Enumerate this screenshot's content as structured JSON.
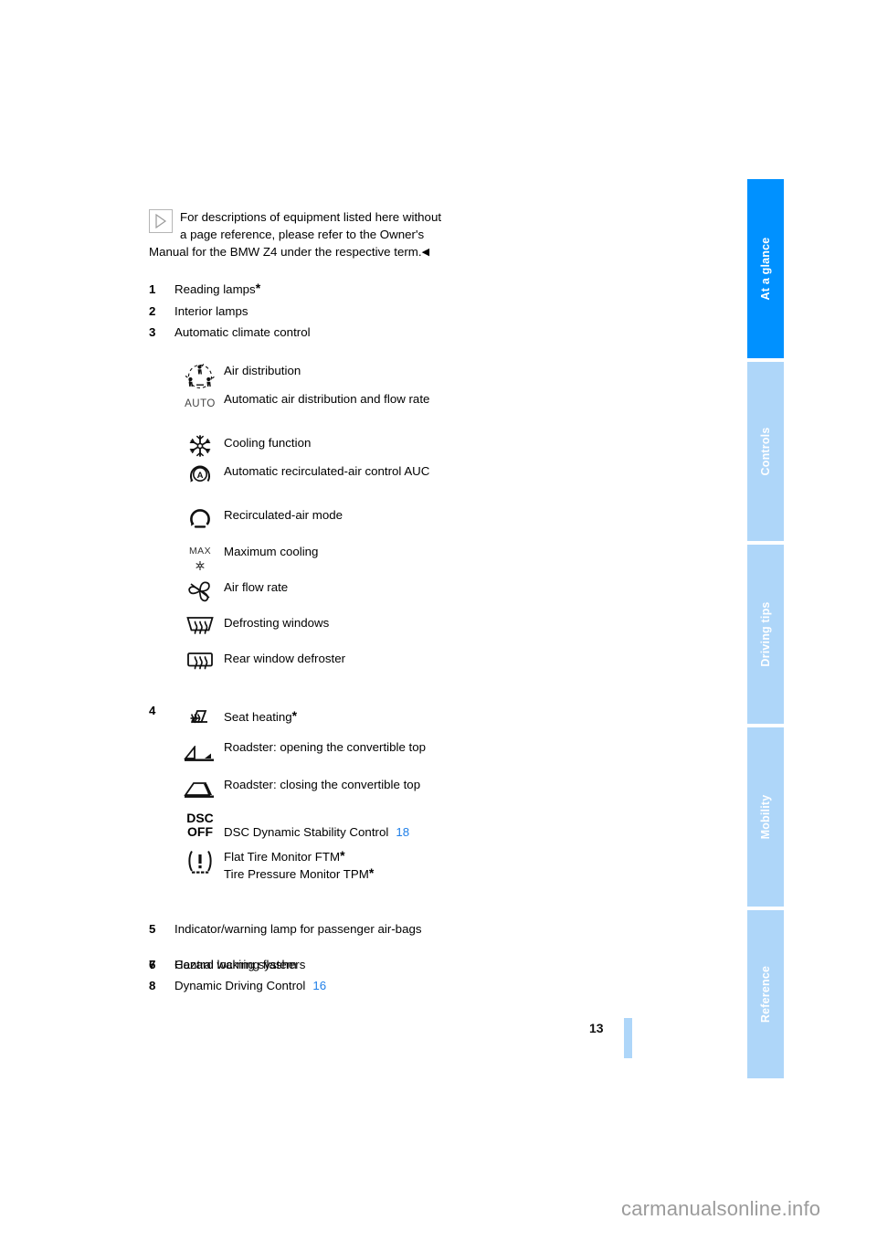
{
  "document": {
    "page_number": "13",
    "watermark": "carmanualsonline.info"
  },
  "note": {
    "icon": "play-triangle-outline-icon",
    "text": "For descriptions of equipment listed here without a page reference, please refer to the Owner's Manual for the BMW Z4 under the respective term.",
    "end_marker": "◀"
  },
  "numbered_items": [
    {
      "num": "1",
      "text": "Reading lamps",
      "star": "*"
    },
    {
      "num": "2",
      "text": "Interior lamps",
      "star": ""
    },
    {
      "num": "3",
      "text": "Automatic climate control",
      "star": ""
    },
    {
      "num": "4",
      "text": "",
      "star": ""
    },
    {
      "num": "5",
      "text": "Indicator/warning lamp for passenger air-bags",
      "star": ""
    },
    {
      "num": "6",
      "text": "Central locking system",
      "star": ""
    },
    {
      "num": "7",
      "text": "Hazard warning flashers",
      "star": ""
    },
    {
      "num": "8",
      "text": "Dynamic Driving Control",
      "star": "",
      "pageref": "16"
    }
  ],
  "climate_icons": [
    {
      "icon": "air-distribution-icon",
      "label": "Air distribution"
    },
    {
      "icon": "auto-text-icon",
      "icon_text": "AUTO",
      "label": "Automatic air distribution and flow rate"
    },
    {
      "icon": "snowflake-icon",
      "label": "Cooling function"
    },
    {
      "icon": "auc-recirculation-auto-icon",
      "label": "Automatic recirculated-air control AUC"
    },
    {
      "icon": "recirculation-icon",
      "label": "Recirculated-air mode"
    },
    {
      "icon": "max-cooling-icon",
      "icon_text": "MAX",
      "label": "Maximum cooling"
    },
    {
      "icon": "fan-icon",
      "label": "Air flow rate"
    },
    {
      "icon": "windshield-defrost-icon",
      "label": "Defrosting windows"
    },
    {
      "icon": "rear-window-defrost-icon",
      "label": "Rear window defroster"
    }
  ],
  "control_icons": [
    {
      "icon": "seat-heating-icon",
      "label": "Seat heating",
      "star": "*"
    },
    {
      "icon": "convertible-top-open-icon",
      "label": "Roadster: opening the convertible top",
      "star": ""
    },
    {
      "icon": "convertible-top-close-icon",
      "label": "Roadster: closing the convertible top",
      "star": ""
    },
    {
      "icon": "dsc-off-icon",
      "icon_text_1": "DSC",
      "icon_text_2": "OFF",
      "label": "DSC Dynamic Stability Control",
      "pageref": "18",
      "star": ""
    },
    {
      "icon": "flat-tire-monitor-icon",
      "label_line_1": "Flat Tire Monitor FTM",
      "label_line_2": "Tire Pressure Monitor TPM",
      "star": "*"
    }
  ],
  "tabs": [
    {
      "label": "At a glance",
      "active": true
    },
    {
      "label": "Controls",
      "active": false
    },
    {
      "label": "Driving tips",
      "active": false
    },
    {
      "label": "Mobility",
      "active": false
    },
    {
      "label": "Reference",
      "active": false
    }
  ],
  "colors": {
    "tab_active": "#0091ff",
    "tab_inactive": "#aed6f9",
    "page_link": "#1f7fe8",
    "watermark": "#9b9b9b"
  }
}
